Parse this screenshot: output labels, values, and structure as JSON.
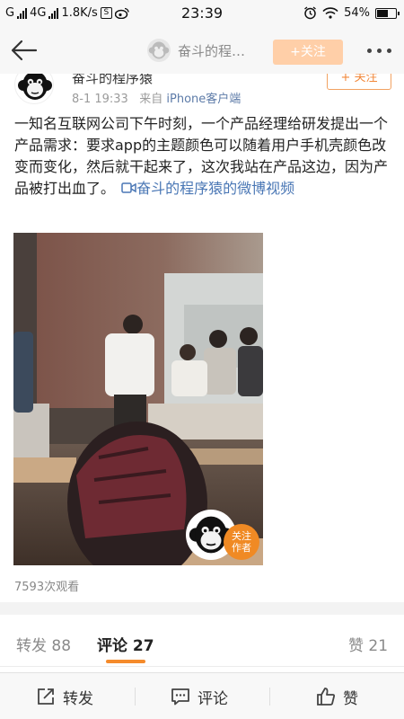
{
  "status": {
    "carrier": "G",
    "network": "4G",
    "speed": "1.8K/s",
    "sbox": "S",
    "time": "23:39",
    "battery": "54%"
  },
  "navbar": {
    "title": "奋斗的程…",
    "follow_label": "+关注"
  },
  "post": {
    "author": "奋斗的程序猿",
    "follow_label": "+ 关注",
    "date": "8-1 19:33",
    "source_prefix": "来自",
    "source": "iPhone客户端",
    "text": "一知名互联网公司下午时刻，一个产品经理给研发提出一个产品需求：要求app的主题颜色可以随着用户手机壳颜色改变而变化，然后就干起来了，这次我站在产品这边，因为产品被打出血了。",
    "video_link": "奋斗的程序猿的微博视频",
    "video_badge_line1": "关注",
    "video_badge_line2": "作者",
    "views": "7593次观看"
  },
  "tabs": {
    "repost_label": "转发",
    "repost_count": "88",
    "comment_label": "评论",
    "comment_count": "27",
    "like_label": "赞",
    "like_count": "21"
  },
  "bottom": {
    "repost": "转发",
    "comment": "评论",
    "like": "赞"
  }
}
